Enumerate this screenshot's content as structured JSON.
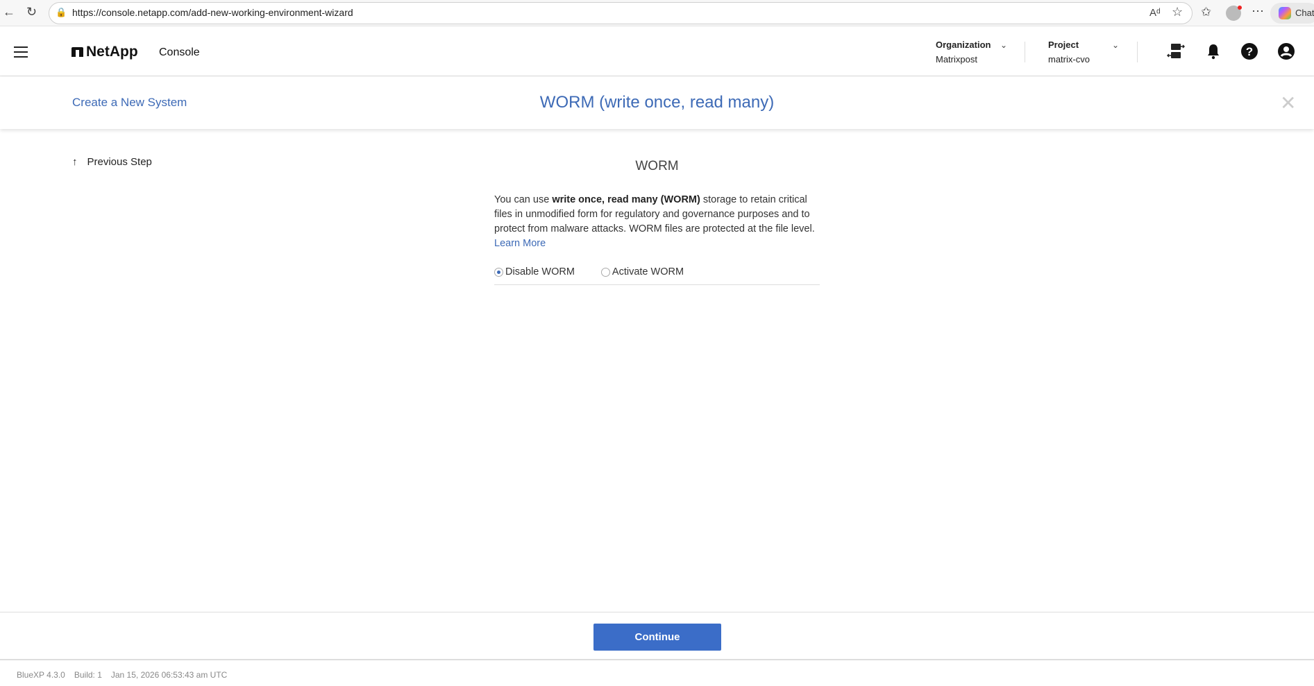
{
  "browser": {
    "url": "https://console.netapp.com/add-new-working-environment-wizard",
    "chat_label": "Chat"
  },
  "header": {
    "brand": "NetApp",
    "product": "Console",
    "organization": {
      "label": "Organization",
      "value": "Matrixpost"
    },
    "project": {
      "label": "Project",
      "value": "matrix-cvo"
    }
  },
  "wizard": {
    "breadcrumb": "Create a New System",
    "title": "WORM (write once, read many)",
    "previous_step": "Previous Step"
  },
  "section": {
    "heading": "WORM",
    "desc_pre": "You can use ",
    "desc_bold": "write once, read many (WORM)",
    "desc_post": " storage to retain critical files in unmodified form for regulatory and governance purposes and to protect from malware attacks. WORM files are protected at the file level.",
    "learn_more": "Learn More",
    "options": [
      {
        "label": "Disable WORM",
        "selected": true
      },
      {
        "label": "Activate WORM",
        "selected": false
      }
    ]
  },
  "actions": {
    "continue": "Continue"
  },
  "footer": {
    "version": "BlueXP 4.3.0",
    "build": "Build: 1",
    "timestamp": "Jan 15, 2026 06:53:43 am UTC"
  },
  "colors": {
    "accent": "#3b6dc8",
    "link": "#3d6ab6"
  }
}
